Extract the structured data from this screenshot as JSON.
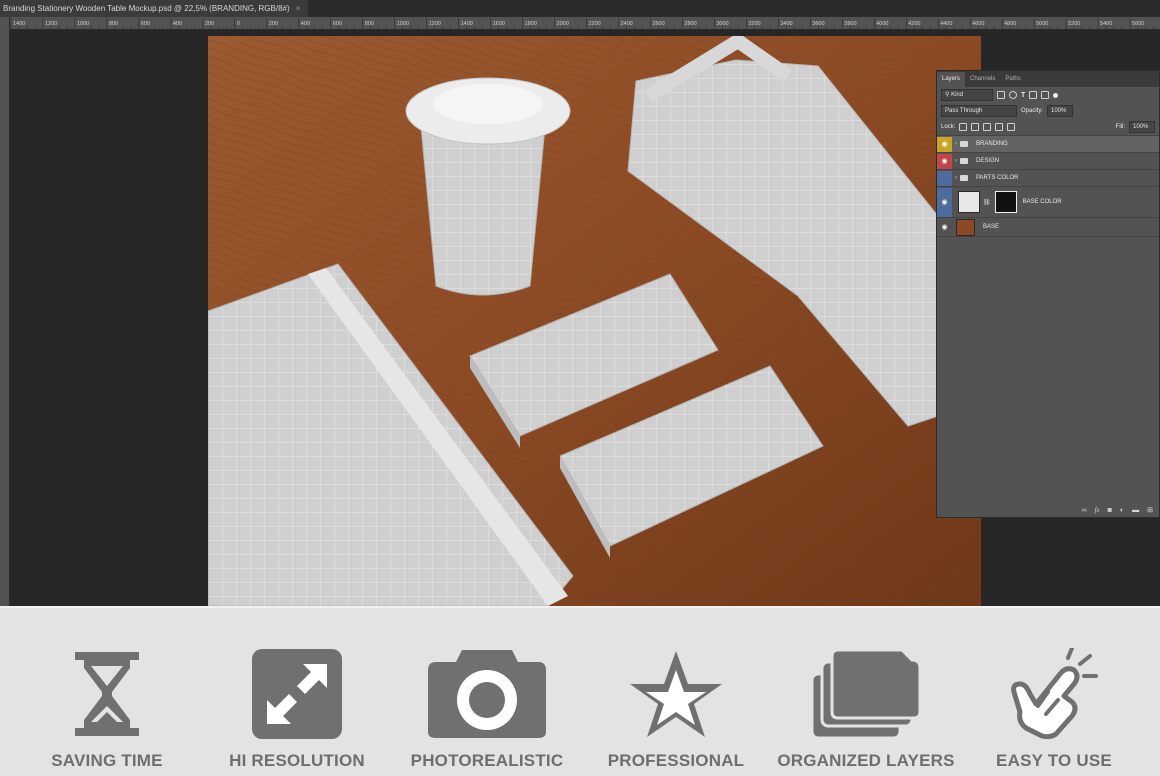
{
  "window": {
    "doc_tab": "Branding Stationery Wooden Table Mockup.psd @ 22,5% (BRANDING, RGB/8#)",
    "close_glyph": "×"
  },
  "ruler": {
    "labels": [
      "1400",
      "1200",
      "1000",
      "800",
      "600",
      "400",
      "200",
      "0",
      "200",
      "400",
      "600",
      "800",
      "1000",
      "1200",
      "1400",
      "1600",
      "1800",
      "2000",
      "2200",
      "2400",
      "2600",
      "2800",
      "3000",
      "3200",
      "3400",
      "3600",
      "3800",
      "4000",
      "4200",
      "4400",
      "4600",
      "4800",
      "5000",
      "5200",
      "5400",
      "5600"
    ]
  },
  "layers_panel": {
    "tabs": [
      "Layers",
      "Channels",
      "Paths"
    ],
    "filter_kind": "Kind",
    "blend_mode": "Pass Through",
    "opacity_label": "Opacity:",
    "opacity_value": "100%",
    "lock_label": "Lock:",
    "fill_label": "Fill:",
    "fill_value": "100%",
    "layers": [
      {
        "name": "BRANDING",
        "type": "group",
        "color": "#c9a526"
      },
      {
        "name": "DESIGN",
        "type": "group",
        "color": "#c0464a"
      },
      {
        "name": "PARTS COLOR",
        "type": "group",
        "color": "#4d6b9c"
      },
      {
        "name": "BASE COLOR",
        "type": "adjustment",
        "color": "#4d6b9c"
      },
      {
        "name": "BASE",
        "type": "image",
        "color": ""
      }
    ],
    "footer_icons": [
      "link-icon",
      "fx-icon",
      "mask-icon",
      "adjustment-icon",
      "folder-icon",
      "new-layer-icon"
    ]
  },
  "features": [
    {
      "label": "SAVING TIME",
      "icon": "hourglass-icon"
    },
    {
      "label": "HI RESOLUTION",
      "icon": "expand-icon"
    },
    {
      "label": "PHOTOREALISTIC",
      "icon": "camera-icon"
    },
    {
      "label": "PROFESSIONAL",
      "icon": "star-icon"
    },
    {
      "label": "ORGANIZED LAYERS",
      "icon": "layers-icon"
    },
    {
      "label": "EASY TO USE",
      "icon": "hand-tap-icon"
    }
  ],
  "colors": {
    "feature_icon": "#707070",
    "feature_bg": "#e3e3e3",
    "wood": "#8a4a25",
    "mockup_paper": "#d2d2d2"
  }
}
